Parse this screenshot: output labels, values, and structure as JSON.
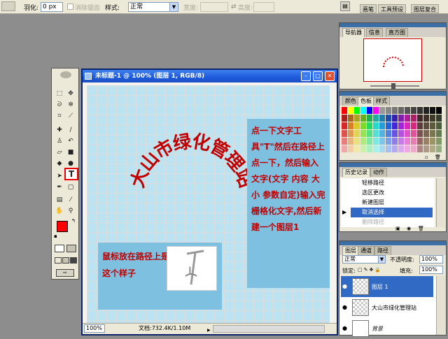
{
  "options_bar": {
    "feather_label": "羽化:",
    "feather_value": "0 px",
    "antialias_label": "消除锯齿",
    "style_label": "样式:",
    "style_value": "正常",
    "width_label": "宽度:",
    "height_label": "高度:"
  },
  "palette_well": {
    "tabs": [
      "画笔",
      "工具预设",
      "图层复合"
    ]
  },
  "document": {
    "title": "未标题-1 @ 100% (图层 1, RGB/8)",
    "zoom": "100%",
    "doc_info": "文档:732.4K/1.10M",
    "path_text": "大山市绿化管理站",
    "note_right": "点一下文字工具\"T\"然后在路径上点一下，然后输入文字(文字 内容 大小 参数自定)输入完栅格化文字,然后新建一个图层1",
    "note_left": "鼠标放在路径上是这个样子"
  },
  "navigator": {
    "tabs": [
      "导航器",
      "信息",
      "直方图"
    ]
  },
  "color_panel": {
    "tabs": [
      "颜色",
      "色板",
      "样式"
    ]
  },
  "history": {
    "tabs": [
      "历史记录",
      "动作"
    ],
    "items": [
      "轻移路径",
      "选区更改",
      "新建图层",
      "取消选择",
      "删除路径"
    ],
    "selected": 3
  },
  "layers": {
    "tabs": [
      "图层",
      "通道",
      "路径"
    ],
    "blend_mode": "正常",
    "opacity_label": "不透明度:",
    "opacity_value": "100%",
    "lock_label": "锁定:",
    "fill_label": "填充:",
    "fill_value": "100%",
    "items": [
      {
        "name": "图层 1",
        "selected": true
      },
      {
        "name": "大山市绿化管理站",
        "selected": false
      },
      {
        "name": "背景",
        "selected": false
      }
    ]
  },
  "colors": {
    "foreground": "#ff0000",
    "background": "#ffffff",
    "accent": "#316ac5",
    "text_red": "#c00000",
    "canvas_bg": "#bce3f1"
  }
}
